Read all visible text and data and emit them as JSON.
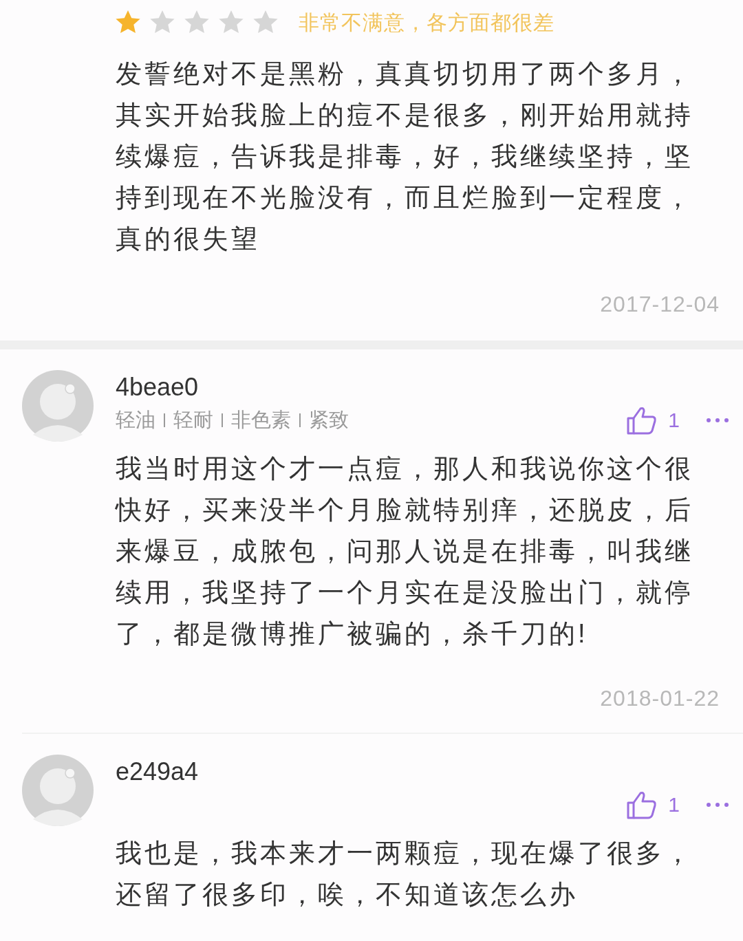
{
  "reviews": [
    {
      "kind": "rated",
      "stars": 1,
      "rating_label": "非常不满意，各方面都很差",
      "text": "发誓绝对不是黑粉，真真切切用了两个多月，其实开始我脸上的痘不是很多，刚开始用就持续爆痘，告诉我是排毒，好，我继续坚持，坚持到现在不光脸没有，而且烂脸到一定程度，真的很失望",
      "date": "2017-12-04"
    },
    {
      "kind": "user",
      "user": "4beae0",
      "tags": [
        "轻油",
        "轻耐",
        "非色素",
        "紧致"
      ],
      "likes": "1",
      "text": "我当时用这个才一点痘，那人和我说你这个很快好，买来没半个月脸就特别痒，还脱皮，后来爆豆，成脓包，问那人说是在排毒，叫我继续用，我坚持了一个月实在是没脸出门，就停了，都是微博推广被骗的，杀千刀的!",
      "date": "2018-01-22"
    },
    {
      "kind": "user",
      "user": "e249a4",
      "likes": "1",
      "text": "我也是，我本来才一两颗痘，现在爆了很多，还留了很多印，唉，不知道该怎么办"
    }
  ]
}
